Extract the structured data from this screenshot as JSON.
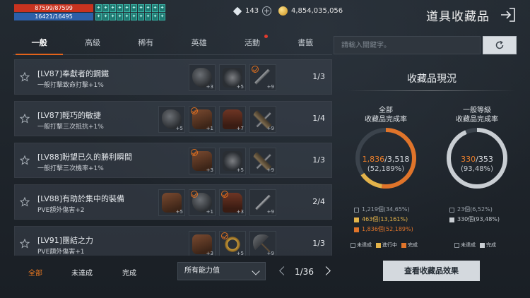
{
  "status": {
    "hp_text": "87599/87599",
    "mp_text": "16421/16495",
    "buff_icons": [
      "buff-icon",
      "buff-icon",
      "buff-icon",
      "buff-icon",
      "buff-icon",
      "buff-icon",
      "buff-icon",
      "buff-icon",
      "buff-icon",
      "buff-icon",
      "buff-icon",
      "buff-icon",
      "buff-icon",
      "buff-icon",
      "buff-icon",
      "buff-icon",
      "buff-icon",
      "buff-icon",
      "buff-icon",
      "buff-icon"
    ]
  },
  "currency": {
    "diamonds": "143",
    "gold": "4,854,035,056"
  },
  "header": {
    "title": "道具收藏品"
  },
  "tabs": [
    {
      "label": "一般",
      "active": true
    },
    {
      "label": "高級",
      "active": false
    },
    {
      "label": "稀有",
      "active": false
    },
    {
      "label": "英雄",
      "active": false
    },
    {
      "label": "活動",
      "active": false,
      "notify": true
    },
    {
      "label": "書籤",
      "active": false
    }
  ],
  "search": {
    "placeholder": "請輸入關鍵字。",
    "value": ""
  },
  "collections": [
    {
      "name": "[LV87]奉獻者的鋼鐵",
      "effect": "一般打擊致命打擊+1%",
      "count": "1/3",
      "slots": [
        {
          "item": "helmet",
          "plus": "+3",
          "done": false
        },
        {
          "item": "claws",
          "plus": "+5",
          "done": false
        },
        {
          "item": "spear",
          "plus": "+9",
          "done": true
        }
      ]
    },
    {
      "name": "[LV87]輕巧的敏捷",
      "effect": "一般打擊三次抵抗+1%",
      "count": "1/4",
      "slots": [
        {
          "item": "helmet",
          "plus": "+5",
          "done": false
        },
        {
          "item": "bracer",
          "plus": "+1",
          "done": true
        },
        {
          "item": "boots",
          "plus": "+7",
          "done": false
        },
        {
          "item": "crossbow",
          "plus": "+9",
          "done": false
        }
      ]
    },
    {
      "name": "[LV88]盼望已久的勝利瞬間",
      "effect": "一般打擊三次機率+1%",
      "count": "1/3",
      "slots": [
        {
          "item": "bracer",
          "plus": "+3",
          "done": true
        },
        {
          "item": "claws",
          "plus": "+5",
          "done": false
        },
        {
          "item": "crossbow",
          "plus": "+9",
          "done": false
        }
      ]
    },
    {
      "name": "[LV88]有助於集中的裝備",
      "effect": "PVE額外傷害+2",
      "count": "2/4",
      "slots": [
        {
          "item": "bracer",
          "plus": "+5",
          "done": false
        },
        {
          "item": "helmet",
          "plus": "+1",
          "done": true
        },
        {
          "item": "boots",
          "plus": "+3",
          "done": true
        },
        {
          "item": "dagger",
          "plus": "+9",
          "done": false
        }
      ]
    },
    {
      "name": "[LV91]團結之力",
      "effect": "PVE額外傷害+1",
      "count": "1/3",
      "slots": [
        {
          "item": "bracer",
          "plus": "+3",
          "done": false
        },
        {
          "item": "ring",
          "plus": "+5",
          "done": true
        },
        {
          "item": "axe",
          "plus": "+9",
          "done": false
        }
      ]
    }
  ],
  "summary": {
    "title": "收藏品現況",
    "total": {
      "label_line1": "全部",
      "label_line2": "收藏品完成率",
      "done": "1,836",
      "total": "/3,518",
      "percent": "(52,189%)",
      "done_fraction": 0.5219,
      "progress_fraction": 0.1316,
      "lines": [
        "1,219個(34,65%)",
        "463個(13,161%)",
        "1,836個(52,189%)"
      ]
    },
    "normal": {
      "label_line1": "一般等級",
      "label_line2": "收藏品完成率",
      "done": "330",
      "total": "/353",
      "percent": "(93,48%)",
      "done_fraction": 0.9348,
      "lines": [
        "23個(6,52%)",
        "330個(93,48%)"
      ]
    },
    "legend": {
      "incomplete": "未達成",
      "in_progress": "進行中",
      "complete": "完成"
    },
    "colors": {
      "complete": "#e0742a",
      "in_progress": "#e3b34a",
      "incomplete": "#3b434c",
      "normal_done": "#c9ced3"
    }
  },
  "footer": {
    "filters": [
      {
        "label": "全部",
        "active": true
      },
      {
        "label": "未達成",
        "active": false
      },
      {
        "label": "完成",
        "active": false
      }
    ],
    "ability_select": "所有能力值",
    "page": "1/36",
    "view_button": "查看收藏品效果"
  }
}
